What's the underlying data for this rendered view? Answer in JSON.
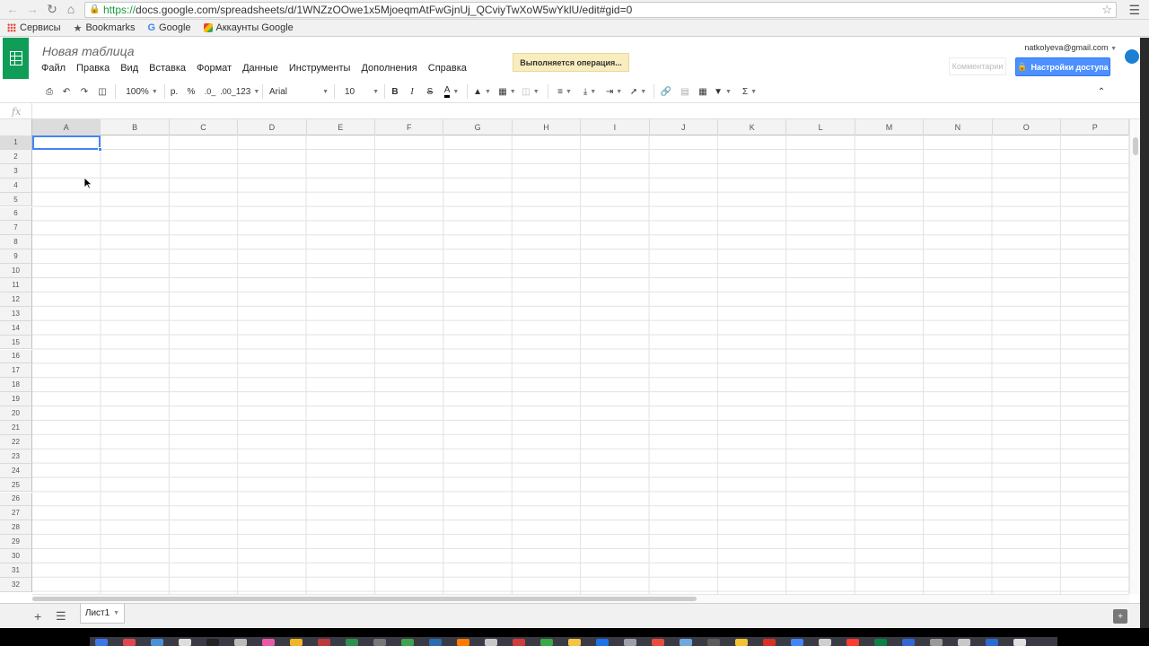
{
  "browser": {
    "url_https": "https://",
    "url_rest": "docs.google.com/spreadsheets/d/1WNZzOOwe1x5MjoeqmAtFwGjnUj_QCviyTwXoW5wYklU/edit#gid=0",
    "bookmarks": [
      {
        "label": "Сервисы",
        "icon": "apps-grid-icon"
      },
      {
        "label": "Bookmarks",
        "icon": "star-icon"
      },
      {
        "label": "Google",
        "icon": "google-icon"
      },
      {
        "label": "Аккаунты Google",
        "icon": "accounts-icon"
      }
    ]
  },
  "app": {
    "doc_title": "Новая таблица",
    "menu": [
      "Файл",
      "Правка",
      "Вид",
      "Вставка",
      "Формат",
      "Данные",
      "Инструменты",
      "Дополнения",
      "Справка"
    ],
    "operation_banner": "Выполняется операция...",
    "user_email": "natkolyeva@gmail.com",
    "comments_label": "Комментарии",
    "share_label": "Настройки доступа",
    "brand_color": "#0f9d58",
    "accent_color": "#4d90fe"
  },
  "toolbar": {
    "zoom": "100%",
    "currency": "р.",
    "percent": "%",
    "decrease_decimals": ".0_",
    "increase_decimals": ".00_",
    "more_formats": "123",
    "font": "Arial",
    "font_size": "10",
    "bold": "B",
    "italic": "I",
    "strike": "S",
    "text_color": "A",
    "sigma": "Σ"
  },
  "formula_bar": {
    "fx": "fx",
    "value": ""
  },
  "grid": {
    "columns": [
      "A",
      "B",
      "C",
      "D",
      "E",
      "F",
      "G",
      "H",
      "I",
      "J",
      "K",
      "L",
      "M",
      "N",
      "O",
      "P"
    ],
    "rows": [
      "1",
      "2",
      "3",
      "4",
      "5",
      "6",
      "7",
      "8",
      "9",
      "10",
      "11",
      "12",
      "13",
      "14",
      "15",
      "16",
      "17",
      "18",
      "19",
      "20",
      "21",
      "22",
      "23",
      "24",
      "25",
      "26",
      "27",
      "28",
      "29",
      "30",
      "31",
      "32"
    ],
    "active_cell": "A1"
  },
  "sheets": {
    "tabs": [
      "Лист1"
    ]
  }
}
